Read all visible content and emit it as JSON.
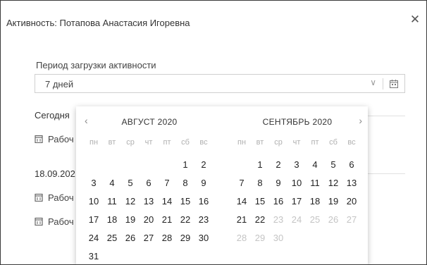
{
  "dialog": {
    "title": "Активность: Потапова Анастасия Игоревна",
    "close_label": "✕"
  },
  "period": {
    "label": "Период загрузки активности",
    "value": "7 дней",
    "chevron": "∨"
  },
  "activity": {
    "today_label": "Сегодня",
    "date2_label": "18.09.202",
    "item_label": "Рабоч"
  },
  "calendar": {
    "prev": "‹",
    "next": "›",
    "weekdays": [
      "пн",
      "вт",
      "ср",
      "чт",
      "пт",
      "сб",
      "вс"
    ],
    "months": [
      {
        "title": "АВГУСТ 2020",
        "lead_blanks": 5,
        "days": [
          "1",
          "2",
          "3",
          "4",
          "5",
          "6",
          "7",
          "8",
          "9",
          "10",
          "11",
          "12",
          "13",
          "14",
          "15",
          "16",
          "17",
          "18",
          "19",
          "20",
          "21",
          "22",
          "23",
          "24",
          "25",
          "26",
          "27",
          "28",
          "29",
          "30",
          "31"
        ],
        "muted_from": 99
      },
      {
        "title": "СЕНТЯБРЬ 2020",
        "lead_blanks": 1,
        "days": [
          "1",
          "2",
          "3",
          "4",
          "5",
          "6",
          "7",
          "8",
          "9",
          "10",
          "11",
          "12",
          "13",
          "14",
          "15",
          "16",
          "17",
          "18",
          "19",
          "20",
          "21",
          "22",
          "23",
          "24",
          "25",
          "26",
          "27",
          "28",
          "29",
          "30"
        ],
        "muted_from": 23
      }
    ]
  },
  "colors": {
    "border": "#3a3a3a",
    "muted_day": "#c4c4c4",
    "weekday": "#b0b0b0"
  }
}
